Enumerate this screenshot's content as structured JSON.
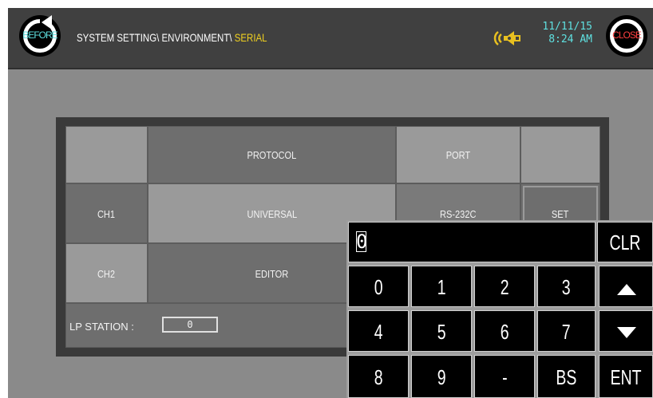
{
  "header": {
    "before_label": "BEFORE",
    "close_label": "CLOSE",
    "breadcrumb": {
      "path": "SYSTEM SETTING\\ ENVIRONMENT\\ ",
      "current": "SERIAL"
    },
    "date": "11/11/15",
    "time": "8:24 AM",
    "colors": {
      "accent_cyan": "#5fe0e0",
      "current_yellow": "#f0d020",
      "close_red": "#ff4040"
    }
  },
  "table": {
    "headers": {
      "protocol": "PROTOCOL",
      "port": "PORT"
    },
    "rows": [
      {
        "channel": "CH1",
        "protocol": "UNIVERSAL",
        "port": "RS-232C",
        "action": "SET"
      },
      {
        "channel": "CH2",
        "protocol": "EDITOR"
      }
    ]
  },
  "lp_station": {
    "label": "LP STATION :",
    "value": "0"
  },
  "keypad": {
    "display_value": "0",
    "clr": "CLR",
    "keys_row1": [
      "0",
      "1",
      "2",
      "3"
    ],
    "keys_row2": [
      "4",
      "5",
      "6",
      "7"
    ],
    "keys_row3": [
      "8",
      "9",
      "-",
      "BS"
    ],
    "enter": "ENT",
    "up_icon": "triangle-up-icon",
    "down_icon": "triangle-down-icon"
  }
}
